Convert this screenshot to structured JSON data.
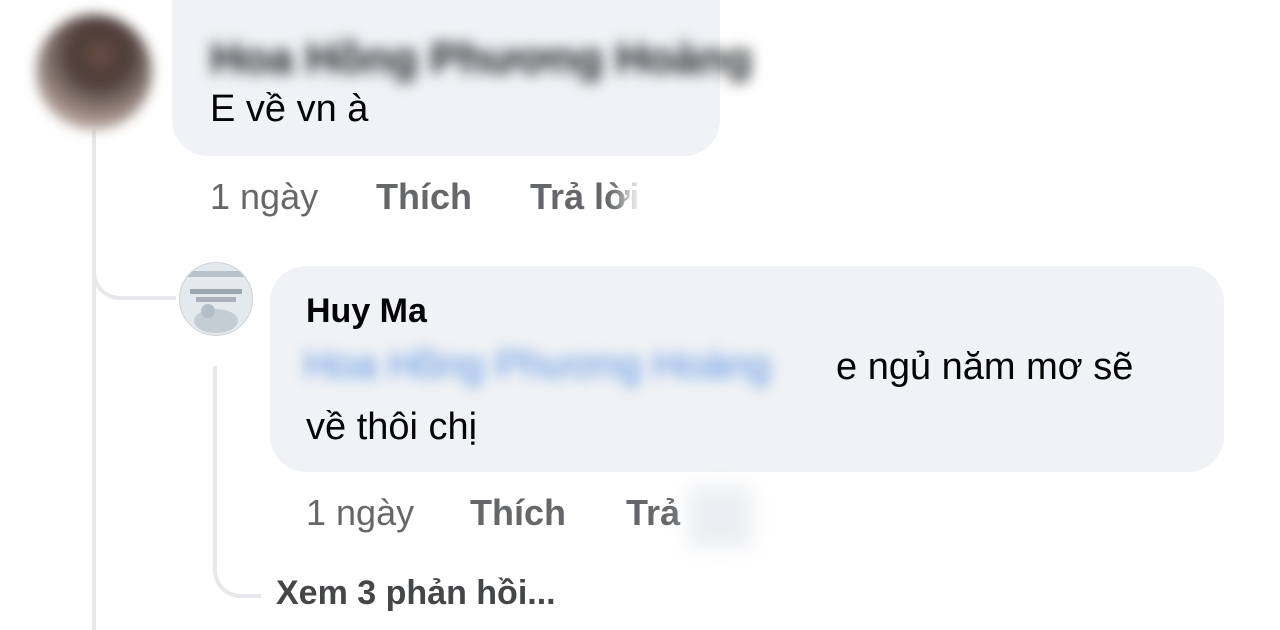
{
  "top_comment": {
    "author_blurred": "Hoa Hồng Phương Hoàng",
    "text": "E về vn à",
    "time": "1 ngày",
    "like_label": "Thích",
    "reply_label": "Trả lời"
  },
  "reply_comment": {
    "author": "Huy Ma",
    "mention_blurred": "Hoa Hồng Phương Hoàng",
    "text_line1": "e ngủ năm mơ sẽ",
    "text_line2": "về thôi chị",
    "time": "1 ngày",
    "like_label": "Thích",
    "reply_label": "Trả"
  },
  "view_more_label": "Xem 3 phản hồi..."
}
